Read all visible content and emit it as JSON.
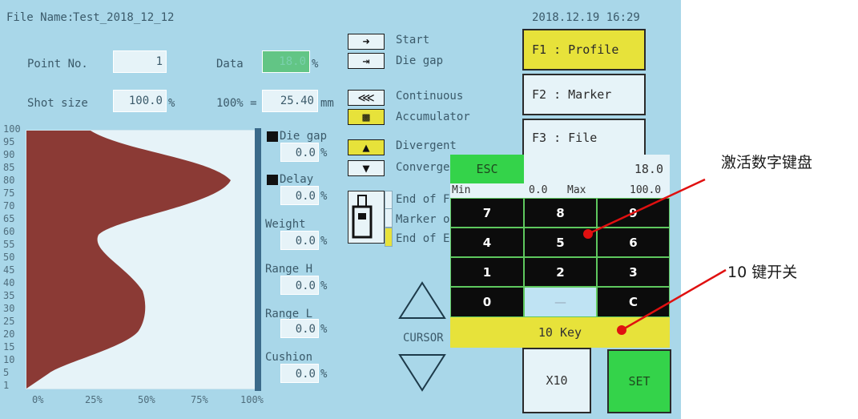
{
  "header": {
    "file_name_label": "File Name:",
    "file_name_value": "Test_2018_12_12",
    "datetime": "2018.12.19 16:29"
  },
  "params": {
    "point_label": "Point No.",
    "point_value": "1",
    "data_label": "Data",
    "data_value": "18.0",
    "data_unit": "%",
    "shot_label": "Shot size",
    "shot_value": "100.0",
    "shot_unit": "%",
    "hundred_label": "100% =",
    "hundred_value": "25.40",
    "hundred_unit": "mm"
  },
  "chart": {
    "y_ticks": [
      "100",
      "95",
      "90",
      "85",
      "80",
      "75",
      "70",
      "65",
      "60",
      "55",
      "50",
      "45",
      "40",
      "35",
      "30",
      "25",
      "20",
      "15",
      "10",
      "5",
      "1"
    ],
    "x_ticks": [
      "0%",
      "25%",
      "50%",
      "75%",
      "100%"
    ]
  },
  "side_fields": {
    "die_gap_label": "Die gap",
    "die_gap_value": "0.0",
    "die_gap_unit": "%",
    "delay_label": "Delay",
    "delay_value": "0.0",
    "delay_unit": "%",
    "weight_label": "Weight",
    "weight_value": "0.0",
    "weight_unit": "%",
    "range_h_label": "Range H",
    "range_h_value": "0.0",
    "range_h_unit": "%",
    "range_l_label": "Range L",
    "range_l_value": "0.0",
    "range_l_unit": "%",
    "cushion_label": "Cushion",
    "cushion_value": "0.0",
    "cushion_unit": "%"
  },
  "modes": {
    "start": "Start",
    "die_gap": "Die gap",
    "continuous": "Continuous",
    "accumulator": "Accumulator",
    "divergent": "Divergent",
    "converge": "Converge",
    "end_of_f": "End of F",
    "marker_o": "Marker o",
    "end_of_e": "End of E",
    "cursor": "CURSOR"
  },
  "fkeys": {
    "f1": "F1 : Profile",
    "f2": "F2 : Marker",
    "f3": "F3 : File"
  },
  "keypad": {
    "esc": "ESC",
    "display_value": "18.0",
    "min_label": "Min",
    "min_value": "0.0",
    "max_label": "Max",
    "max_value": "100.0",
    "keys": [
      "7",
      "8",
      "9",
      "4",
      "5",
      "6",
      "1",
      "2",
      "3",
      "0",
      "—",
      "C"
    ],
    "ten_key": "10 Key"
  },
  "bottom": {
    "x10": "X10",
    "set": "SET"
  },
  "annotations": {
    "keypad_note": "激活数字键盘",
    "tenkey_note": "10 键开关"
  },
  "colors": {
    "screen_bg": "#a9d7e9",
    "profile_fill": "#8b3a35",
    "yellow": "#e7e23a",
    "green": "#34d34a",
    "arrow": "#e01010"
  }
}
